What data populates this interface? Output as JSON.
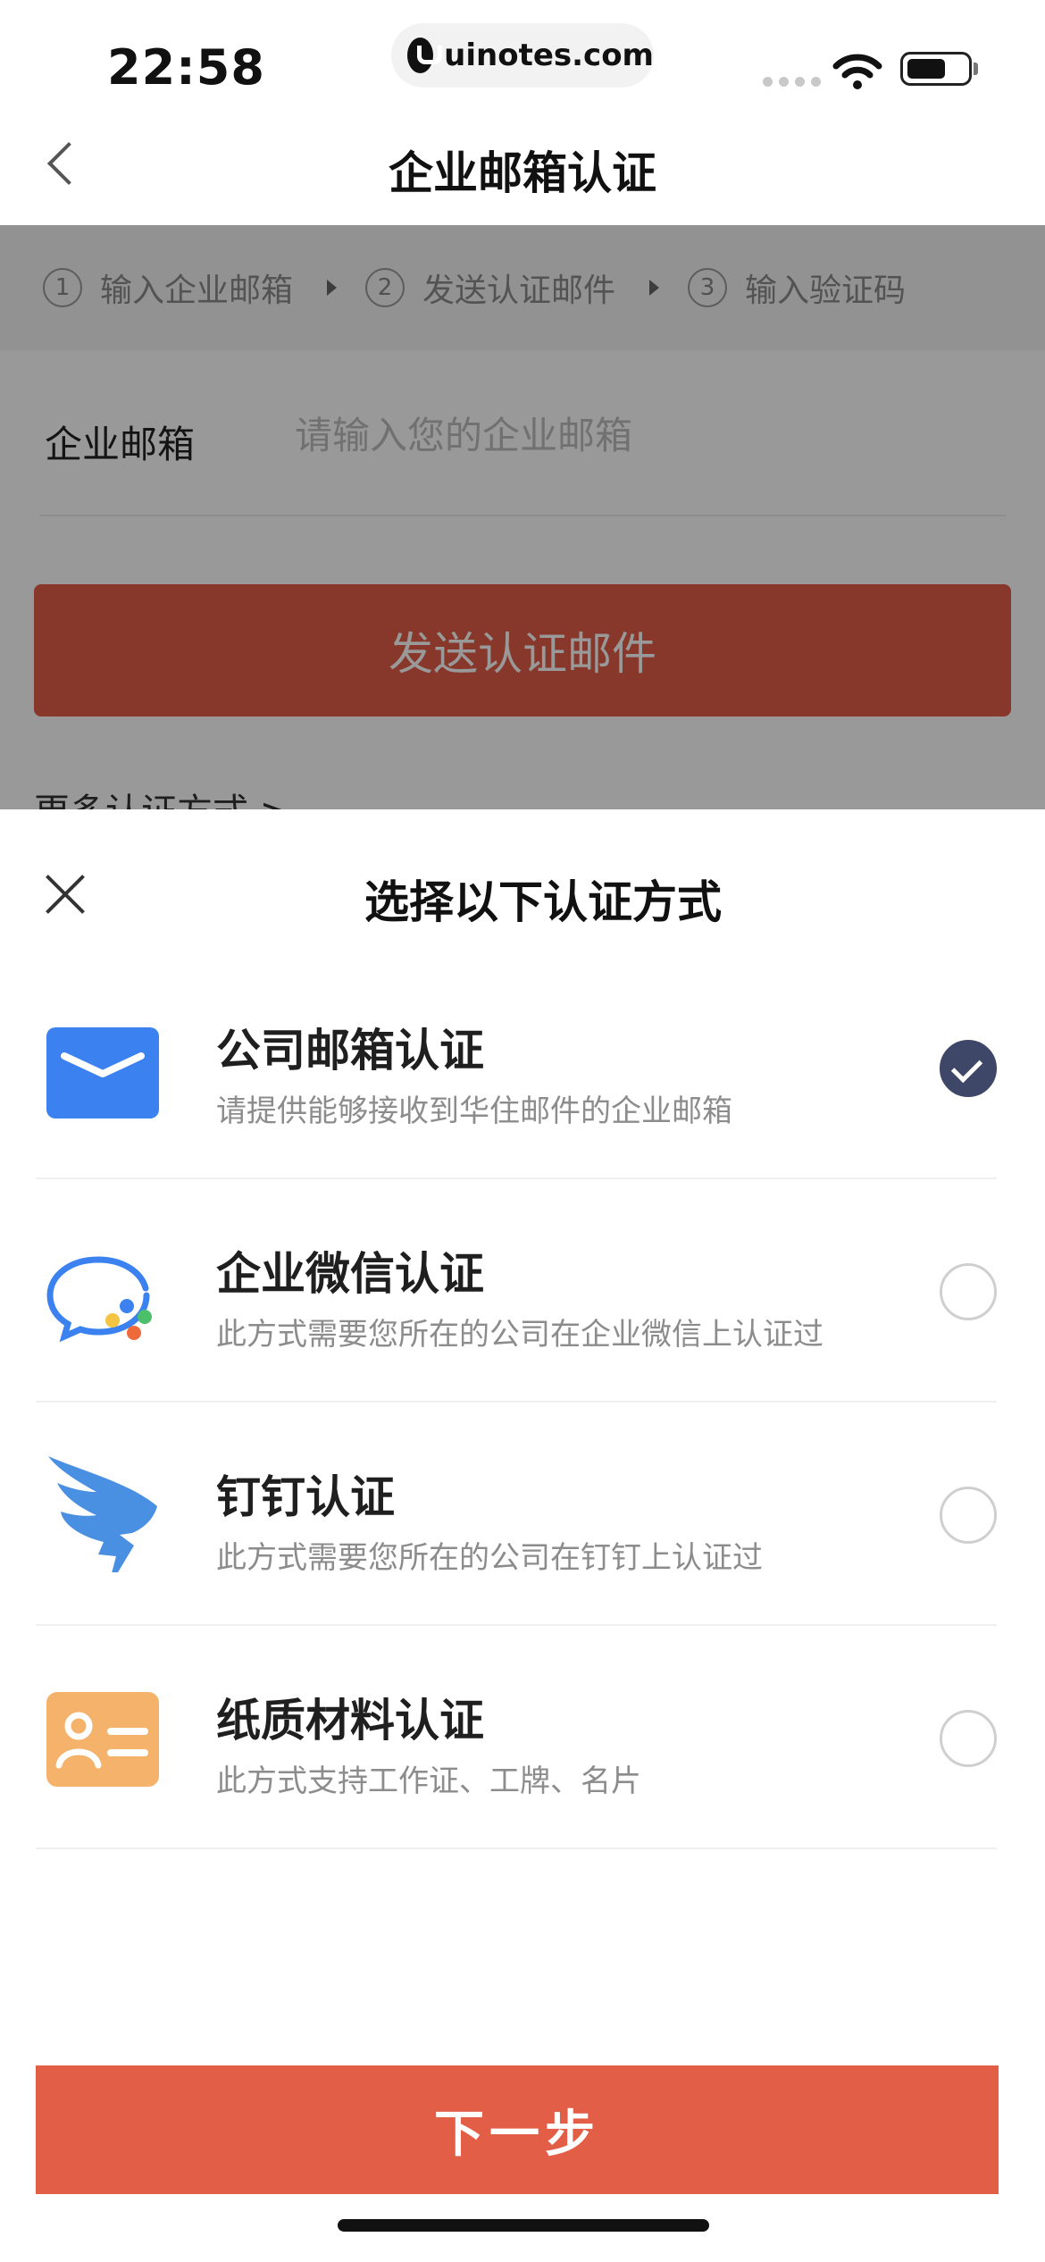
{
  "status_bar": {
    "time": "22:58",
    "url": "uinotes.com"
  },
  "nav": {
    "title": "企业邮箱认证"
  },
  "steps": [
    {
      "num": "1",
      "label": "输入企业邮箱"
    },
    {
      "num": "2",
      "label": "发送认证邮件"
    },
    {
      "num": "3",
      "label": "输入验证码"
    }
  ],
  "form": {
    "email_label": "企业邮箱",
    "email_placeholder": "请输入您的企业邮箱",
    "send_button": "发送认证邮件",
    "more_methods": "更多认证方式 >"
  },
  "sheet": {
    "title": "选择以下认证方式",
    "options": [
      {
        "title": "公司邮箱认证",
        "desc": "请提供能够接收到华住邮件的企业邮箱",
        "icon": "mail-icon",
        "selected": true
      },
      {
        "title": "企业微信认证",
        "desc": "此方式需要您所在的公司在企业微信上认证过",
        "icon": "wecom-icon",
        "selected": false
      },
      {
        "title": "钉钉认证",
        "desc": "此方式需要您所在的公司在钉钉上认证过",
        "icon": "dingtalk-icon",
        "selected": false
      },
      {
        "title": "纸质材料认证",
        "desc": "此方式支持工作证、工牌、名片",
        "icon": "id-card-icon",
        "selected": false
      }
    ],
    "next_button": "下一步"
  },
  "colors": {
    "accent": "#e25e47",
    "selected": "#3f4768",
    "mail_icon": "#3b82f0",
    "dingtalk_icon": "#4a90e2",
    "id_card_icon": "#f4b26b"
  }
}
